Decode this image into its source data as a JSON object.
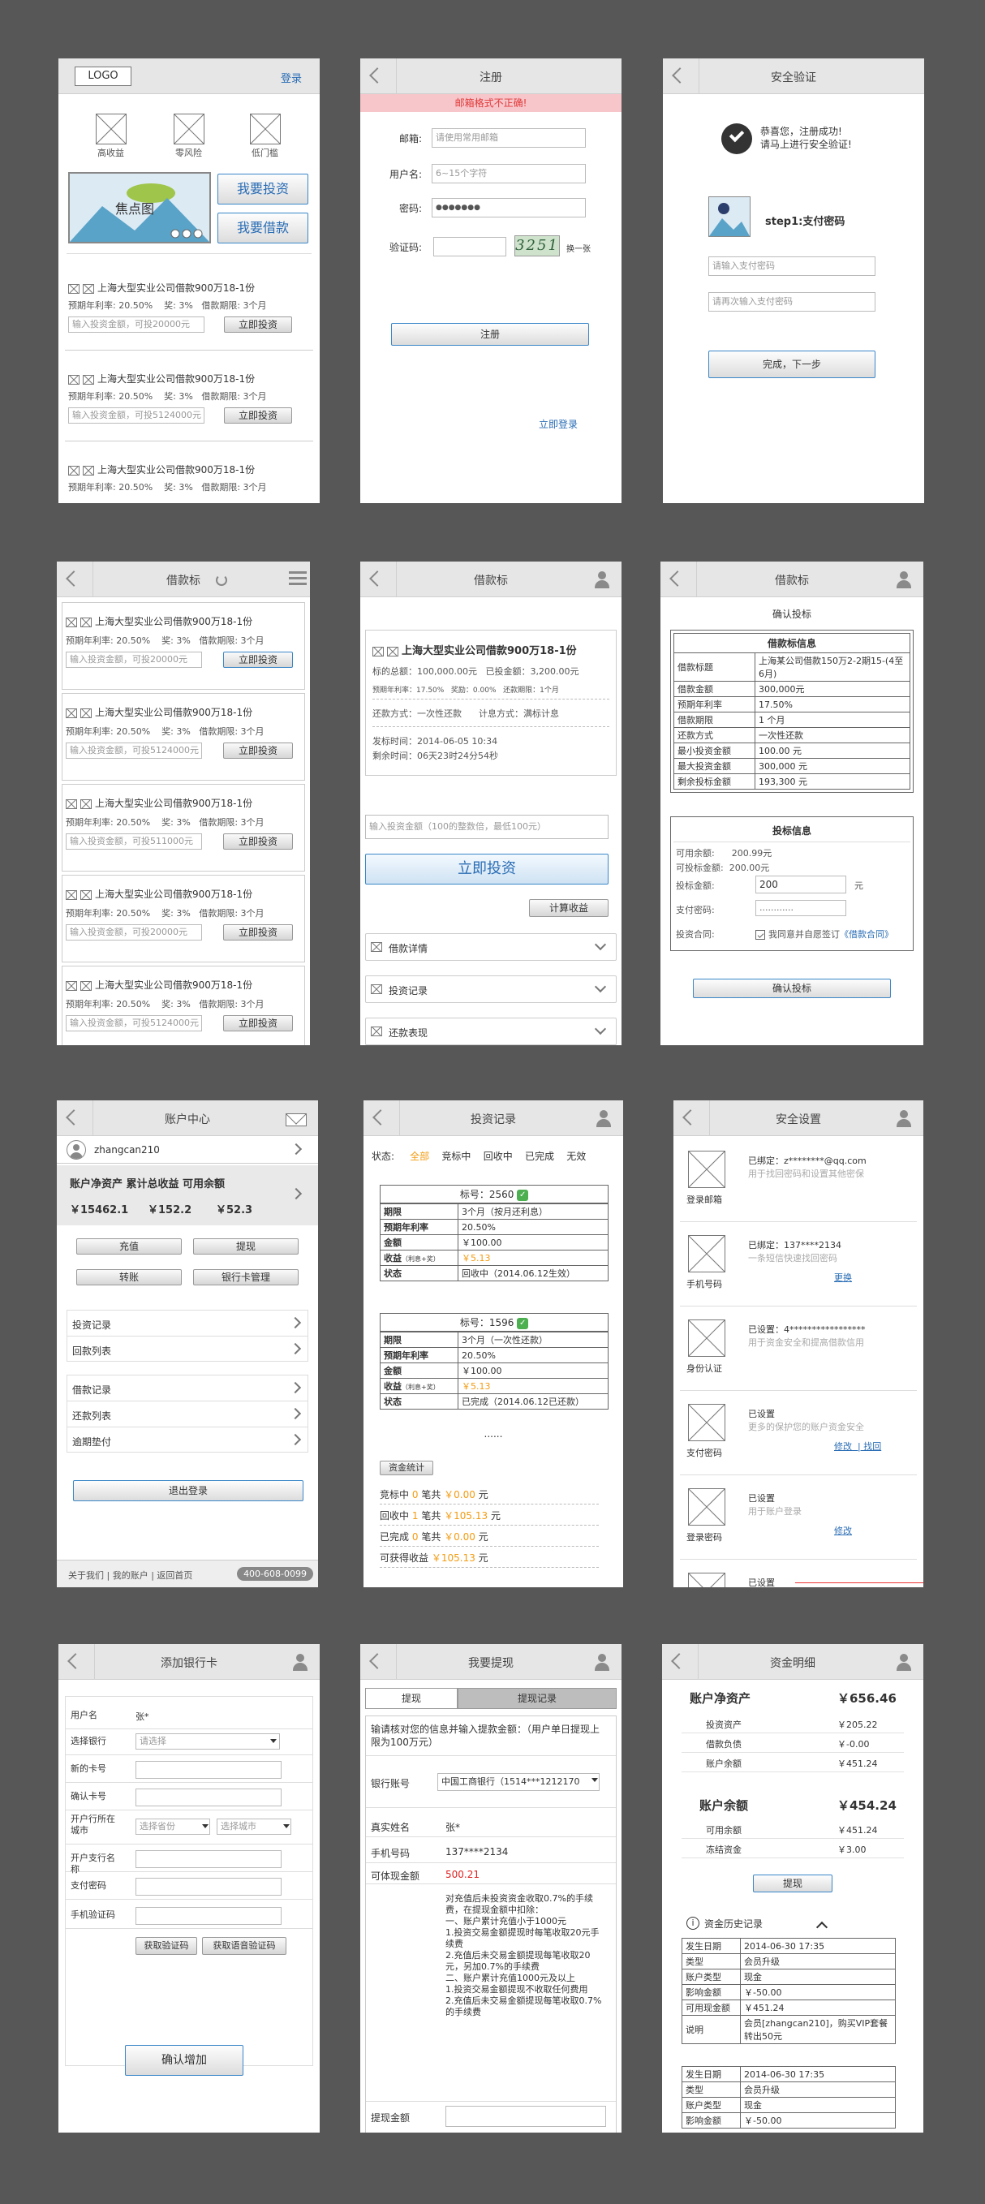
{
  "s1": {
    "logo": "LOGO",
    "login": "登录",
    "icons": [
      "高收益",
      "零风险",
      "低门槛"
    ],
    "banner": "焦点图",
    "invest_btn": "我要投资",
    "borrow_btn": "我要借款",
    "loans": [
      {
        "title": "上海大型实业公司借款900万18-1份",
        "rate_label": "预期年利率:",
        "rate": "20.50%",
        "award": "奖: 3%",
        "term": "借款期限: 3个月",
        "ph": "输入投资金额，可投20000元",
        "btn": "立即投资"
      },
      {
        "title": "上海大型实业公司借款900万18-1份",
        "rate_label": "预期年利率:",
        "rate": "20.50%",
        "award": "奖: 3%",
        "term": "借款期限: 3个月",
        "ph": "输入投资金额，可投5124000元",
        "btn": "立即投资"
      },
      {
        "title": "上海大型实业公司借款900万18-1份",
        "rate_label": "预期年利率:",
        "rate": "20.50%",
        "award": "奖: 3%",
        "term": "借款期限: 3个月"
      }
    ]
  },
  "s2": {
    "title": "注册",
    "error": "邮箱格式不正确!",
    "email_l": "邮箱:",
    "email_ph": "请使用常用邮箱",
    "user_l": "用户名:",
    "user_ph": "6~15个字符",
    "pwd_l": "密码:",
    "pwd_v": "●●●●●●●",
    "code_l": "验证码:",
    "captcha": "3251",
    "refresh": "换一张",
    "submit": "注册",
    "login": "立即登录"
  },
  "s3": {
    "title": "安全验证",
    "msg1": "恭喜您，注册成功!",
    "msg2": "请马上进行安全验证!",
    "step": "step1:支付密码",
    "ph1": "请输入支付密码",
    "ph2": "请再次输入支付密码",
    "next": "完成，下一步"
  },
  "s4": {
    "title": "借款标",
    "loans": [
      {
        "title": "上海大型实业公司借款900万18-1份",
        "rate_label": "预期年利率:",
        "rate": "20.50%",
        "award": "奖: 3%",
        "term": "借款期限: 3个月",
        "ph": "输入投资金额，可投20000元",
        "btn": "立即投资"
      },
      {
        "title": "上海大型实业公司借款900万18-1份",
        "rate_label": "预期年利率:",
        "rate": "20.50%",
        "award": "奖: 3%",
        "term": "借款期限: 3个月",
        "ph": "输入投资金额，可投5124000元",
        "btn": "立即投资"
      },
      {
        "title": "上海大型实业公司借款900万18-1份",
        "rate_label": "预期年利率:",
        "rate": "20.50%",
        "award": "奖: 3%",
        "term": "借款期限: 3个月",
        "ph": "输入投资金额，可投511000元",
        "btn": "立即投资"
      },
      {
        "title": "上海大型实业公司借款900万18-1份",
        "rate_label": "预期年利率:",
        "rate": "20.50%",
        "award": "奖: 3%",
        "term": "借款期限: 3个月",
        "ph": "输入投资金额，可投20000元",
        "btn": "立即投资"
      },
      {
        "title": "上海大型实业公司借款900万18-1份",
        "rate_label": "预期年利率:",
        "rate": "20.50%",
        "award": "奖: 3%",
        "term": "借款期限: 3个月",
        "ph": "输入投资金额，可投5124000元",
        "btn": "立即投资"
      }
    ]
  },
  "s5": {
    "title": "借款标",
    "loan_title": "上海大型实业公司借款900万18-1份",
    "total": "标的总额：100,000.00元",
    "invested": "已投金额：3,200.00元",
    "rate": "预期年利率：17.50%",
    "award": "奖励：0.00%",
    "term": "还款期限：1个月",
    "repay": "还款方式：一次性还款",
    "calc": "计息方式：满标计息",
    "pub": "发标时间：2014-06-05 10:34",
    "left": "剩余时间：06天23时24分54秒",
    "ph": "输入投资金额（100的整数倍，最低100元）",
    "invest": "立即投资",
    "calcbtn": "计算收益",
    "sections": [
      "借款详情",
      "投资记录",
      "还款表现"
    ]
  },
  "s6": {
    "title": "借款标",
    "confirm": "确认投标",
    "info_title": "借款标信息",
    "info": [
      [
        "借款标题",
        "上海某公司借款150万2-2期15-(4至6月)"
      ],
      [
        "借款金额",
        "300,000元"
      ],
      [
        "预期年利率",
        "17.50%"
      ],
      [
        "借款期限",
        "1 个月"
      ],
      [
        "还款方式",
        "一次性还款"
      ],
      [
        "最小投资金额",
        "100.00 元"
      ],
      [
        "最大投资金额",
        "300,000 元"
      ],
      [
        "剩余投标金额",
        "193,300 元"
      ]
    ],
    "bid_title": "投标信息",
    "avail_l": "可用余额:",
    "avail": "200.99元",
    "can_l": "可投标金额:",
    "can": "200.00元",
    "amt_l": "投标金额:",
    "amt": "200",
    "yuan": "元",
    "pay_l": "支付密码:",
    "pay": "............",
    "contract_l": "投资合同:",
    "agree": "我同意并自愿签订",
    "contract": "《借款合同》",
    "btn": "确认投标"
  },
  "s7": {
    "title": "账户中心",
    "user": "zhangcan210",
    "labels": "账户净资产  累计总收益  可用余额",
    "v1": "￥15462.1",
    "v2": "￥152.2",
    "v3": "￥52.3",
    "b1": "充值",
    "b2": "提现",
    "b3": "转账",
    "b4": "银行卡管理",
    "menu1": [
      "投资记录",
      "回款列表"
    ],
    "menu2": [
      "借款记录",
      "还款列表",
      "逾期垫付"
    ],
    "logout": "退出登录",
    "footer": "关于我们 | 我的账户 | 返回首页",
    "phone": "400-608-0099"
  },
  "s8": {
    "title": "投资记录",
    "status_l": "状态:",
    "tabs": [
      "全部",
      "竞标中",
      "回收中",
      "已完成",
      "无效"
    ],
    "rec1": {
      "no": "标号：2560",
      "rows": [
        [
          "期限",
          "3个月（按月还利息）"
        ],
        [
          "预期年利率",
          "20.50%"
        ],
        [
          "金额",
          "￥100.00"
        ],
        [
          "收益",
          "￥5.13"
        ],
        [
          "状态",
          "回收中（2014.06.12生效）"
        ]
      ]
    },
    "rec2": {
      "no": "标号：1596",
      "rows": [
        [
          "期限",
          "3个月（一次性还款）"
        ],
        [
          "预期年利率",
          "20.50%"
        ],
        [
          "金额",
          "￥100.00"
        ],
        [
          "收益",
          "￥5.13"
        ],
        [
          "状态",
          "已完成（2014.06.12已还款）"
        ]
      ]
    },
    "more": "......",
    "stat_btn": "资金统计",
    "note": "（利息+奖）",
    "stats": [
      [
        "竞标中",
        "0",
        "笔共",
        "￥0.00",
        "元"
      ],
      [
        "回收中",
        "1",
        "笔共",
        "￥105.13",
        "元"
      ],
      [
        "已完成",
        "0",
        "笔共",
        "￥0.00",
        "元"
      ],
      [
        "可获得收益",
        "",
        "",
        "￥105.13",
        "元"
      ]
    ]
  },
  "s9": {
    "title": "安全设置",
    "items": [
      {
        "l": "已绑定：z********@qq.com",
        "d": "用于找回密码和设置其他密保",
        "cap": "登录邮箱",
        "a": ""
      },
      {
        "l": "已绑定：137****2134",
        "d": "一条短信快速找回密码",
        "cap": "手机号码",
        "a": "更换"
      },
      {
        "l": "已设置：4*****************",
        "d": "用于资金安全和提高借款信用",
        "cap": "身份认证",
        "a": ""
      },
      {
        "l": "已设置",
        "d": "更多的保护您的账户资金安全",
        "cap": "支付密码",
        "a": "修改  | 找回"
      },
      {
        "l": "已设置",
        "d": "用于账户登录",
        "cap": "登录密码",
        "a": "修改"
      },
      {
        "l": "已设置",
        "d": "",
        "cap": "",
        "a": ""
      }
    ]
  },
  "s10": {
    "title": "添加银行卡",
    "fields": [
      [
        "用户名",
        "张*"
      ],
      [
        "选择银行",
        "请选择"
      ],
      [
        "新的卡号",
        ""
      ],
      [
        "确认卡号",
        ""
      ],
      [
        "开户行所在城市",
        "选择省份"
      ],
      [
        "开户支行名称",
        ""
      ],
      [
        "支付密码",
        ""
      ],
      [
        "手机验证码",
        ""
      ]
    ],
    "city2": "选择城市",
    "sms": "获取验证码",
    "voice": "获取语音验证码",
    "btn": "确认增加"
  },
  "s11": {
    "title": "我要提现",
    "tab1": "提现",
    "tab2": "提现记录",
    "hint": "输请核对您的信息并输入提款金额：（用户单日提现上限为100万元）",
    "bank_l": "银行账号",
    "bank": "中国工商银行（1514***1212170",
    "name_l": "真实姓名",
    "name": "张*",
    "phone_l": "手机号码",
    "phone": "137****2134",
    "avail_l": "可体现金额",
    "avail": "500.21",
    "rules": "对充值后未投资资金收取0.7%的手续费，在提现金额中扣除：\n一、账户累计充值小于1000元\n1.投资交易金额提现时每笔收取20元手续费\n2.充值后未交易金额提现每笔收取20元，另加0.7%的手续费\n二、账户累计充值1000元及以上\n1.投资交易金额提现不收取任何费用\n2.充值后未交易金额提现每笔收取0.7%的手续费",
    "amt_l": "提现金额"
  },
  "s12": {
    "title": "资金明细",
    "net_l": "账户净资产",
    "net": "￥656.46",
    "sub1": [
      [
        "投资资产",
        "￥205.22"
      ],
      [
        "借款负债",
        "￥-0.00"
      ],
      [
        "账户余额",
        "￥451.24"
      ]
    ],
    "bal_l": "账户余额",
    "bal": "￥454.24",
    "sub2": [
      [
        "可用余额",
        "￥451.24"
      ],
      [
        "冻结资金",
        "￥3.00"
      ]
    ],
    "btn": "提现",
    "hist": "资金历史记录",
    "rec1": [
      [
        "发生日期",
        "2014-06-30 17:35"
      ],
      [
        "类型",
        "会员升级"
      ],
      [
        "账户类型",
        "现金"
      ],
      [
        "影响金额",
        "￥-50.00"
      ],
      [
        "可用现金额",
        "￥451.24"
      ],
      [
        "说明",
        "会员[zhangcan210]，购买VIP套餐转出50元"
      ]
    ],
    "rec2": [
      [
        "发生日期",
        "2014-06-30 17:35"
      ],
      [
        "类型",
        "会员升级"
      ],
      [
        "账户类型",
        "现金"
      ],
      [
        "影响金额",
        "￥-50.00"
      ]
    ]
  }
}
